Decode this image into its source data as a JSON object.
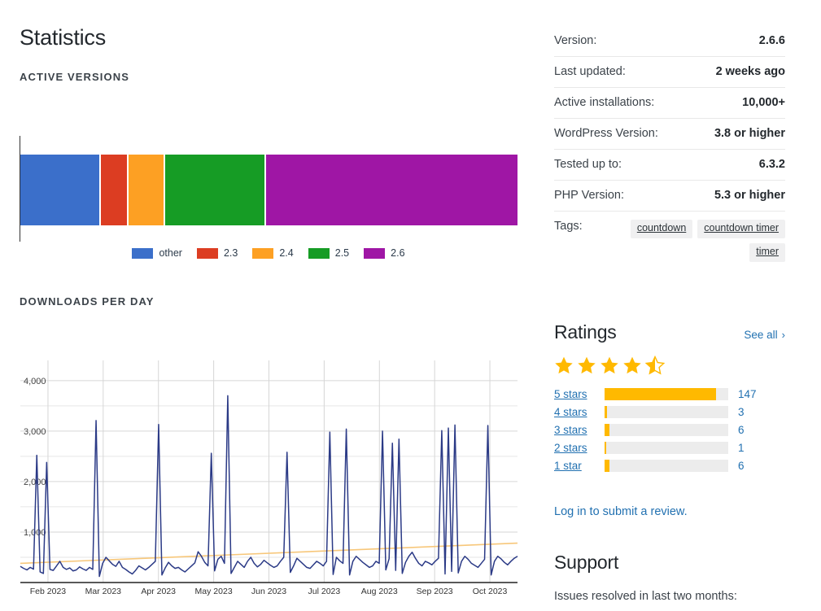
{
  "page_title": "Statistics",
  "sections": {
    "active_versions_label": "ACTIVE VERSIONS",
    "downloads_label": "DOWNLOADS PER DAY"
  },
  "chart_data": [
    {
      "type": "bar",
      "title": "ACTIVE VERSIONS",
      "orientation": "horizontal-stacked",
      "categories": [
        "other",
        "2.3",
        "2.4",
        "2.5",
        "2.6"
      ],
      "values": [
        16.0,
        5.1,
        7.1,
        20.1,
        50.7
      ],
      "colors": [
        "#3b6fca",
        "#dc3d22",
        "#fda023",
        "#169c25",
        "#9f16a5"
      ],
      "legend": {
        "position": "bottom",
        "entries": [
          {
            "label": "other",
            "color": "#3b6fca"
          },
          {
            "label": "2.3",
            "color": "#dc3d22"
          },
          {
            "label": "2.4",
            "color": "#fda023"
          },
          {
            "label": "2.5",
            "color": "#169c25"
          },
          {
            "label": "2.6",
            "color": "#9f16a5"
          }
        ]
      },
      "xlabel": "",
      "ylabel": "",
      "grid": false
    },
    {
      "type": "line",
      "title": "DOWNLOADS PER DAY",
      "ylabel": "",
      "xlabel": "",
      "ylim": [
        0,
        4400
      ],
      "yticks": [
        1000,
        2000,
        3000,
        4000
      ],
      "ytick_labels": [
        "1,000",
        "2,000",
        "3,000",
        "4,000"
      ],
      "minor_yticks": [
        500,
        1500,
        2500,
        3500
      ],
      "grid": true,
      "xticks": [
        "Feb 2023",
        "Mar 2023",
        "Apr 2023",
        "May 2023",
        "Jun 2023",
        "Jul 2023",
        "Aug 2023",
        "Sep 2023",
        "Oct 2023"
      ],
      "series": [
        {
          "name": "Downloads",
          "color": "#2b3a86",
          "values": [
            320,
            280,
            250,
            300,
            265,
            2520,
            210,
            180,
            2380,
            260,
            240,
            330,
            420,
            300,
            260,
            290,
            230,
            250,
            310,
            270,
            240,
            300,
            260,
            3210,
            120,
            380,
            500,
            430,
            360,
            320,
            420,
            300,
            260,
            210,
            170,
            240,
            330,
            290,
            250,
            300,
            360,
            420,
            3130,
            150,
            290,
            400,
            330,
            280,
            300,
            250,
            210,
            270,
            330,
            390,
            610,
            520,
            400,
            330,
            2560,
            230,
            460,
            520,
            380,
            3700,
            180,
            300,
            420,
            360,
            300,
            420,
            500,
            380,
            310,
            360,
            440,
            390,
            340,
            300,
            330,
            420,
            500,
            2580,
            200,
            330,
            480,
            420,
            360,
            300,
            280,
            350,
            420,
            380,
            330,
            420,
            2980,
            160,
            500,
            430,
            380,
            3040,
            150,
            420,
            520,
            460,
            400,
            350,
            300,
            330,
            420,
            380,
            3000,
            250,
            470,
            2760,
            240,
            2840,
            180,
            400,
            520,
            600,
            480,
            380,
            330,
            420,
            390,
            350,
            420,
            480,
            3010,
            170,
            3060,
            220,
            3120,
            190,
            420,
            520,
            460,
            380,
            340,
            300,
            380,
            460,
            3110,
            150,
            420,
            520,
            470,
            400,
            350,
            420,
            480,
            520
          ]
        },
        {
          "name": "Trend",
          "color": "#f7c77a",
          "values": [
            380,
            780
          ]
        }
      ]
    }
  ],
  "sidebar": {
    "meta": [
      {
        "key": "Version:",
        "value": "2.6.6"
      },
      {
        "key": "Last updated:",
        "value": "2 weeks ago"
      },
      {
        "key": "Active installations:",
        "value": "10,000+"
      },
      {
        "key": "WordPress Version:",
        "value": "3.8 or higher"
      },
      {
        "key": "Tested up to:",
        "value": "6.3.2"
      },
      {
        "key": "PHP Version:",
        "value": "5.3 or higher"
      }
    ],
    "tags_label": "Tags:",
    "tags": [
      "countdown",
      "countdown timer",
      "timer"
    ],
    "ratings": {
      "heading": "Ratings",
      "see_all": "See all",
      "see_all_chevron": "›",
      "stars_filled": 4,
      "stars_half": 1,
      "stars_total": 5,
      "star_color": "#ffb900",
      "rows": [
        {
          "label": "5 stars",
          "count": "147",
          "percent": 90
        },
        {
          "label": "4 stars",
          "count": "3",
          "percent": 2
        },
        {
          "label": "3 stars",
          "count": "6",
          "percent": 4
        },
        {
          "label": "2 stars",
          "count": "1",
          "percent": 1
        },
        {
          "label": "1 star",
          "count": "6",
          "percent": 4
        }
      ],
      "review_link": "Log in to submit a review."
    },
    "support": {
      "heading": "Support",
      "issues_line": "Issues resolved in last two months:"
    }
  }
}
